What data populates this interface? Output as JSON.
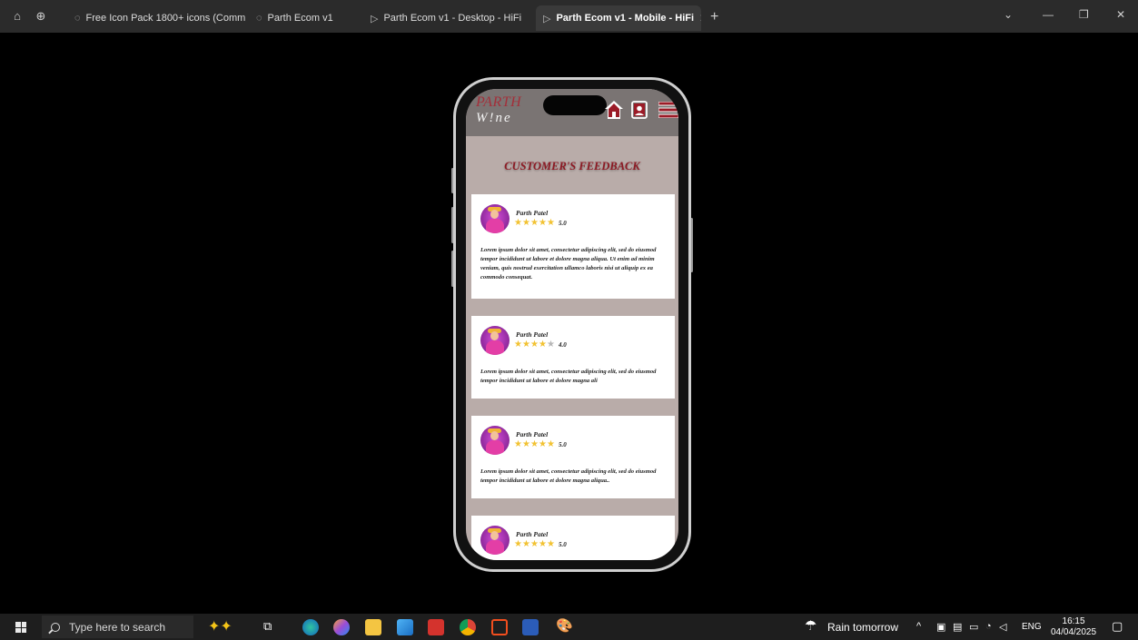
{
  "tabs": [
    {
      "label": "Free Icon Pack 1800+ icons (Commu",
      "icon": "figma-community-icon",
      "active": false
    },
    {
      "label": "Parth Ecom v1",
      "icon": "figma-community-icon",
      "active": false
    },
    {
      "label": "Parth Ecom v1 - Desktop - HiFi",
      "icon": "play-icon",
      "active": false
    },
    {
      "label": "Parth Ecom v1 - Mobile - HiFi",
      "icon": "play-icon",
      "active": true
    }
  ],
  "app": {
    "logo_top": "PARTH",
    "logo_bottom": "W!ne",
    "section_title": "CUSTOMER'S FEEDBACK"
  },
  "reviews": [
    {
      "name": "Parth Patel",
      "stars": 5,
      "rating": "5.0",
      "text": "Lorem ipsum dolor sit amet, consectetur adipiscing elit, sed do eiusmod tempor incididunt ut labore et dolore magna aliqua. Ut enim ad minim veniam, quis nostrud exercitation ullamco laboris nisi ut aliquip ex ea commodo consequat."
    },
    {
      "name": "Parth Patel",
      "stars": 4,
      "rating": "4.0",
      "text": "Lorem ipsum dolor sit amet, consectetur adipiscing elit, sed do eiusmod tempor incididunt ut labore et dolore magna ali"
    },
    {
      "name": "Parth Patel",
      "stars": 5,
      "rating": "5.0",
      "text": "Lorem ipsum dolor sit amet, consectetur adipiscing elit, sed do eiusmod tempor incididunt ut labore et dolore magna aliqua.."
    },
    {
      "name": "Parth Patel",
      "stars": 5,
      "rating": "5.0",
      "text": ""
    }
  ],
  "taskbar": {
    "search_placeholder": "Type here to search",
    "weather": "Rain tomorrow",
    "language": "ENG",
    "time": "16:15",
    "date": "04/04/2025"
  },
  "colors": {
    "accent_red": "#8d1a24",
    "header_bg": "#7a7473",
    "screen_bg": "#b9aca9",
    "star_on": "#f2c232",
    "star_off": "#b7b7b7"
  }
}
